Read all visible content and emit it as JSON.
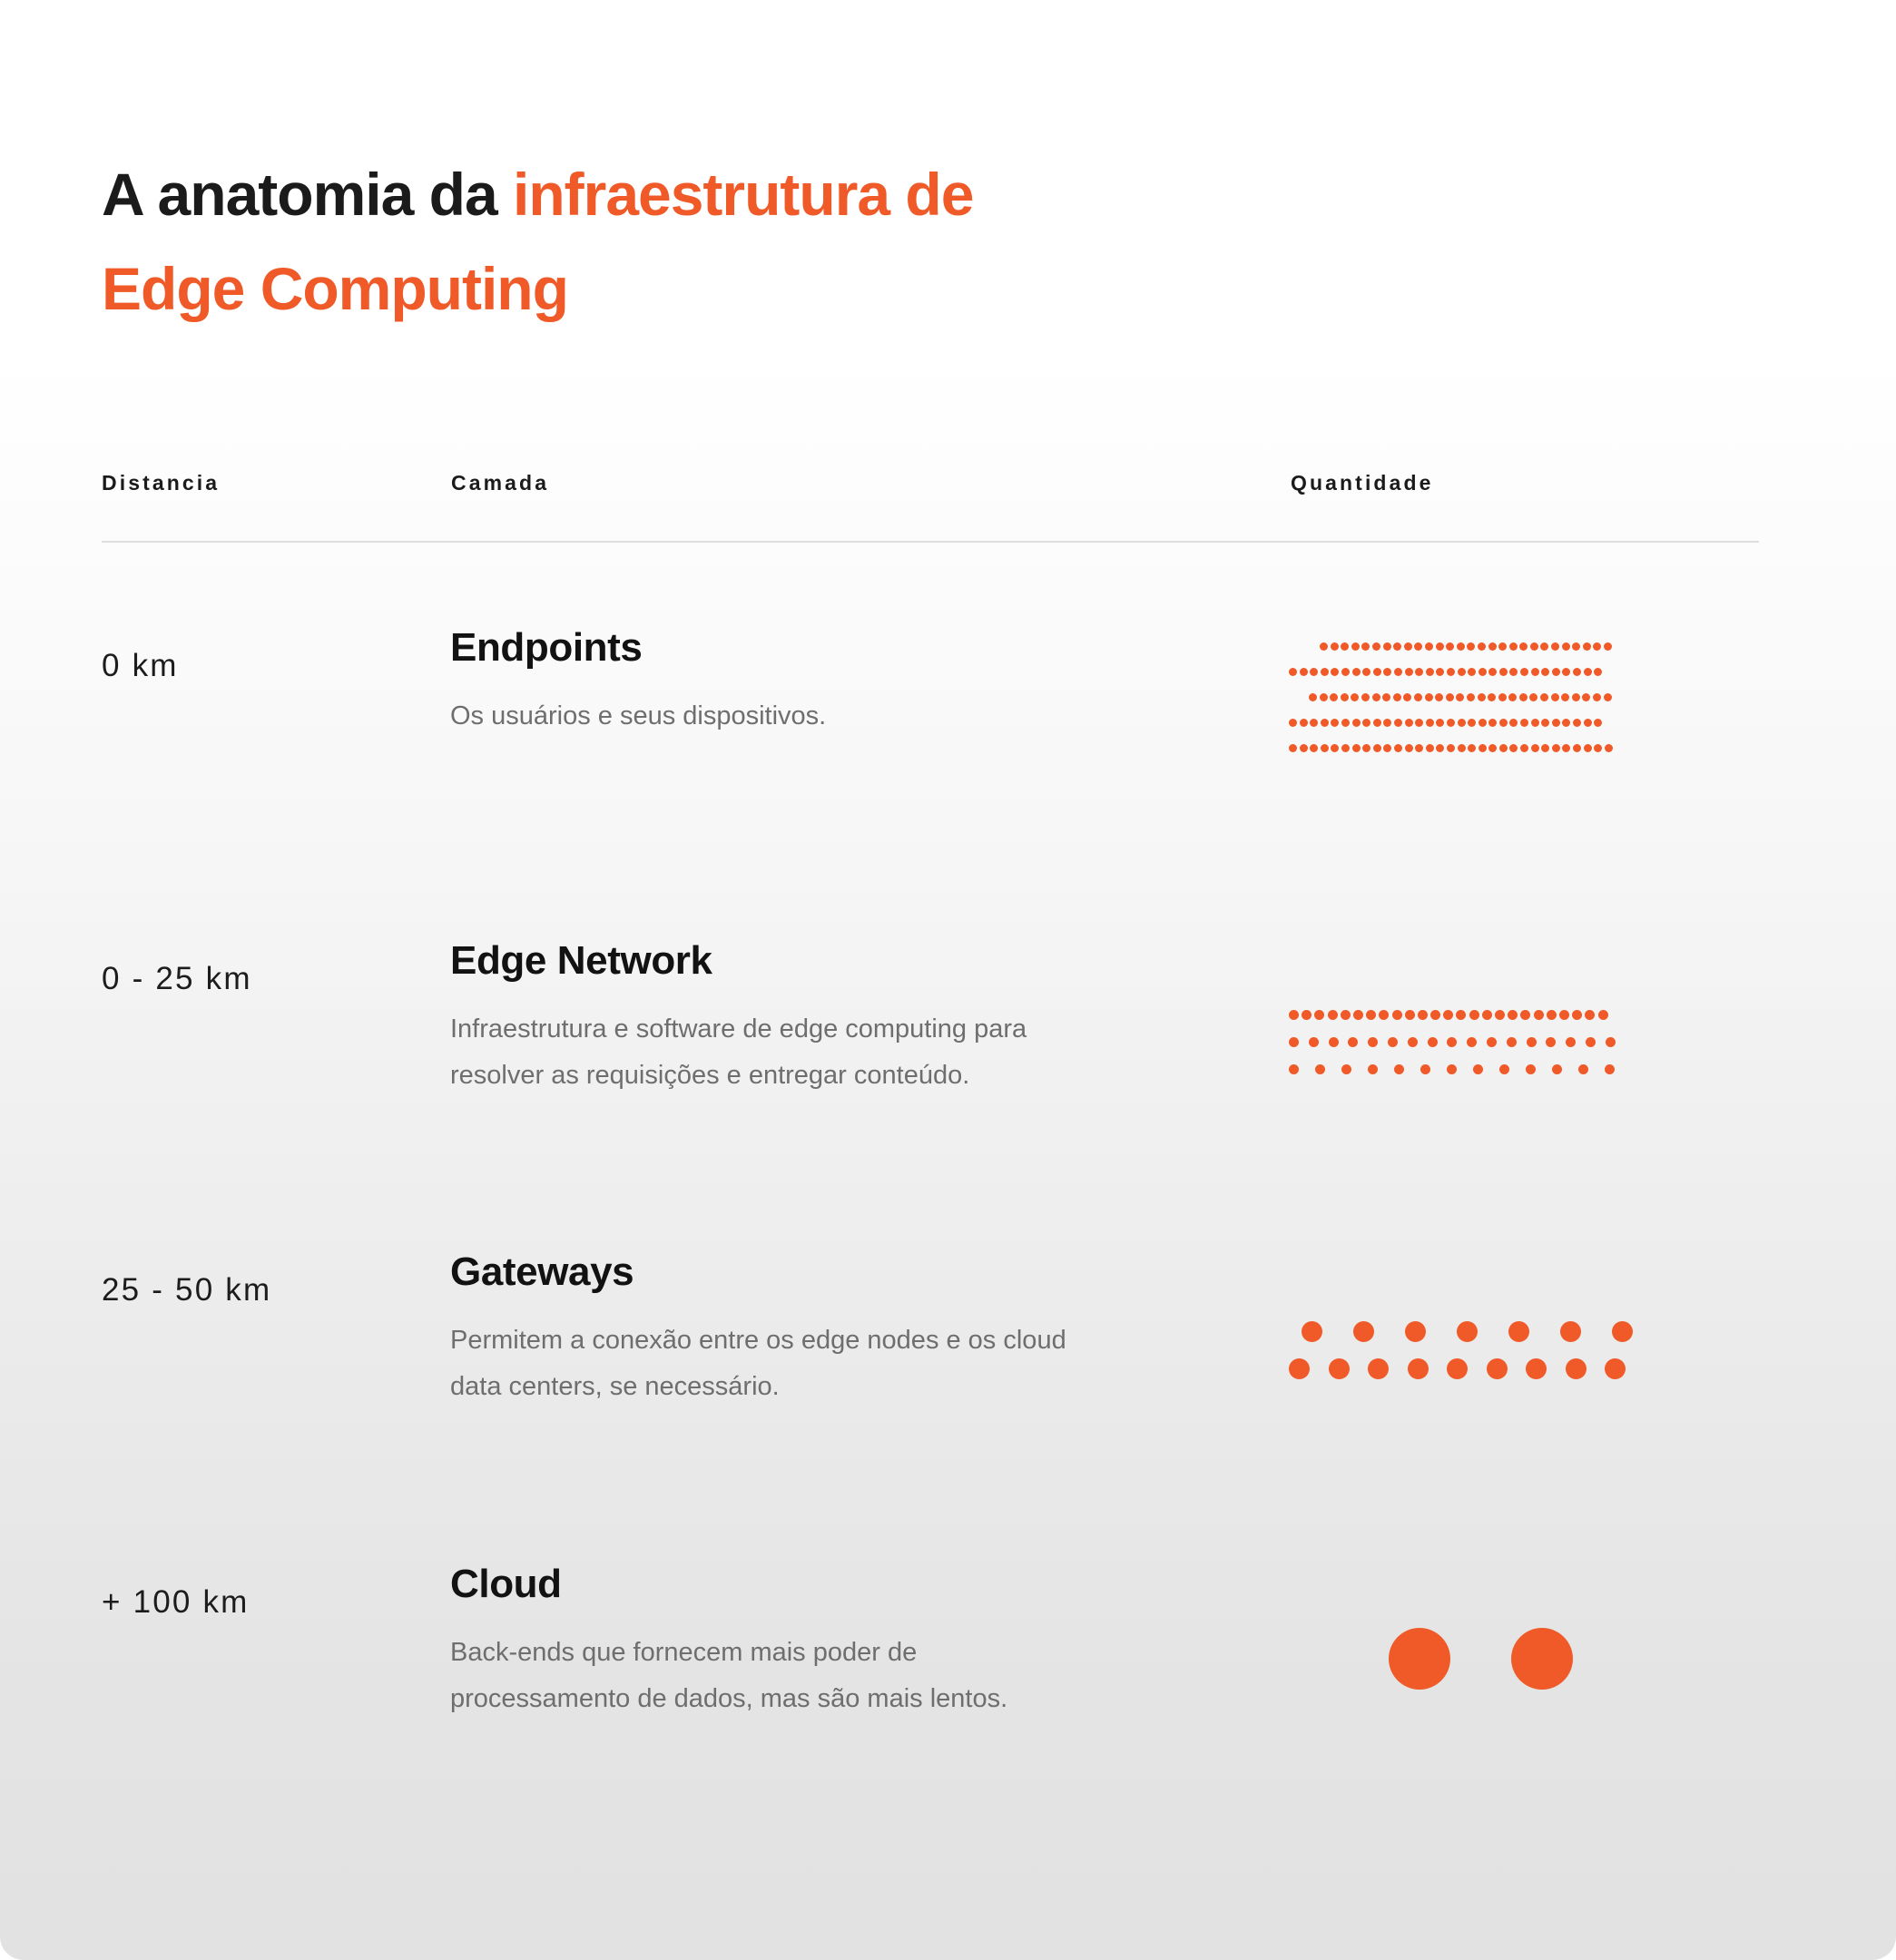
{
  "colors": {
    "accent": "#F05A28",
    "title_dark": "#1b1b1b",
    "body_text": "#6e6e6e",
    "divider": "#dedede",
    "bg_top": "#ffffff",
    "bg_bottom": "#e2e2e2"
  },
  "title": {
    "line1_dark": "A anatomia da ",
    "line1_accent": "infraestrutura de",
    "line2_accent": "Edge Computing"
  },
  "headers": {
    "distance": "Distancia",
    "layer": "Camada",
    "quantity": "Quantidade"
  },
  "chart_data": {
    "type": "table",
    "title": "A anatomia da infraestrutura de Edge Computing",
    "columns": [
      "Distancia",
      "Camada",
      "Quantidade"
    ],
    "rows": [
      {
        "distance": "0 km",
        "layer": "Endpoints",
        "description": "Os usuários e seus dispositivos.",
        "dot_rows": [
          {
            "count": 28,
            "size": 9,
            "gap": 11.6,
            "indent": 34
          },
          {
            "count": 30,
            "size": 9,
            "gap": 11.6,
            "indent": 0
          },
          {
            "count": 29,
            "size": 9,
            "gap": 11.6,
            "indent": 22
          },
          {
            "count": 30,
            "size": 9,
            "gap": 11.6,
            "indent": 0
          },
          {
            "count": 31,
            "size": 9,
            "gap": 11.6,
            "indent": 0
          }
        ],
        "total_dots": 148
      },
      {
        "distance": "0 - 25 km",
        "layer": "Edge Network",
        "description": "Infraestrutura e software de edge computing para resolver as requisições e entregar conteúdo.",
        "dot_rows": [
          {
            "count": 25,
            "size": 11,
            "gap": 14.2,
            "indent": 0
          },
          {
            "count": 17,
            "size": 11,
            "gap": 21.8,
            "indent": 0
          },
          {
            "count": 13,
            "size": 11,
            "gap": 29.0,
            "indent": 0
          }
        ],
        "total_dots": 55
      },
      {
        "distance": "25 - 50 km",
        "layer": "Gateways",
        "description": "Permitem a conexão entre os edge nodes e os cloud data centers, se necessário.",
        "dot_rows": [
          {
            "count": 7,
            "size": 23,
            "gap": 57.0,
            "indent": 14
          },
          {
            "count": 9,
            "size": 23,
            "gap": 43.5,
            "indent": 0
          }
        ],
        "total_dots": 16
      },
      {
        "distance": "+ 100 km",
        "layer": "Cloud",
        "description": "Back-ends que fornecem mais poder de processamento de dados, mas são mais lentos.",
        "dot_rows": [
          {
            "count": 2,
            "size": 68,
            "gap": 135.0,
            "indent": 110
          }
        ],
        "total_dots": 2
      }
    ]
  }
}
